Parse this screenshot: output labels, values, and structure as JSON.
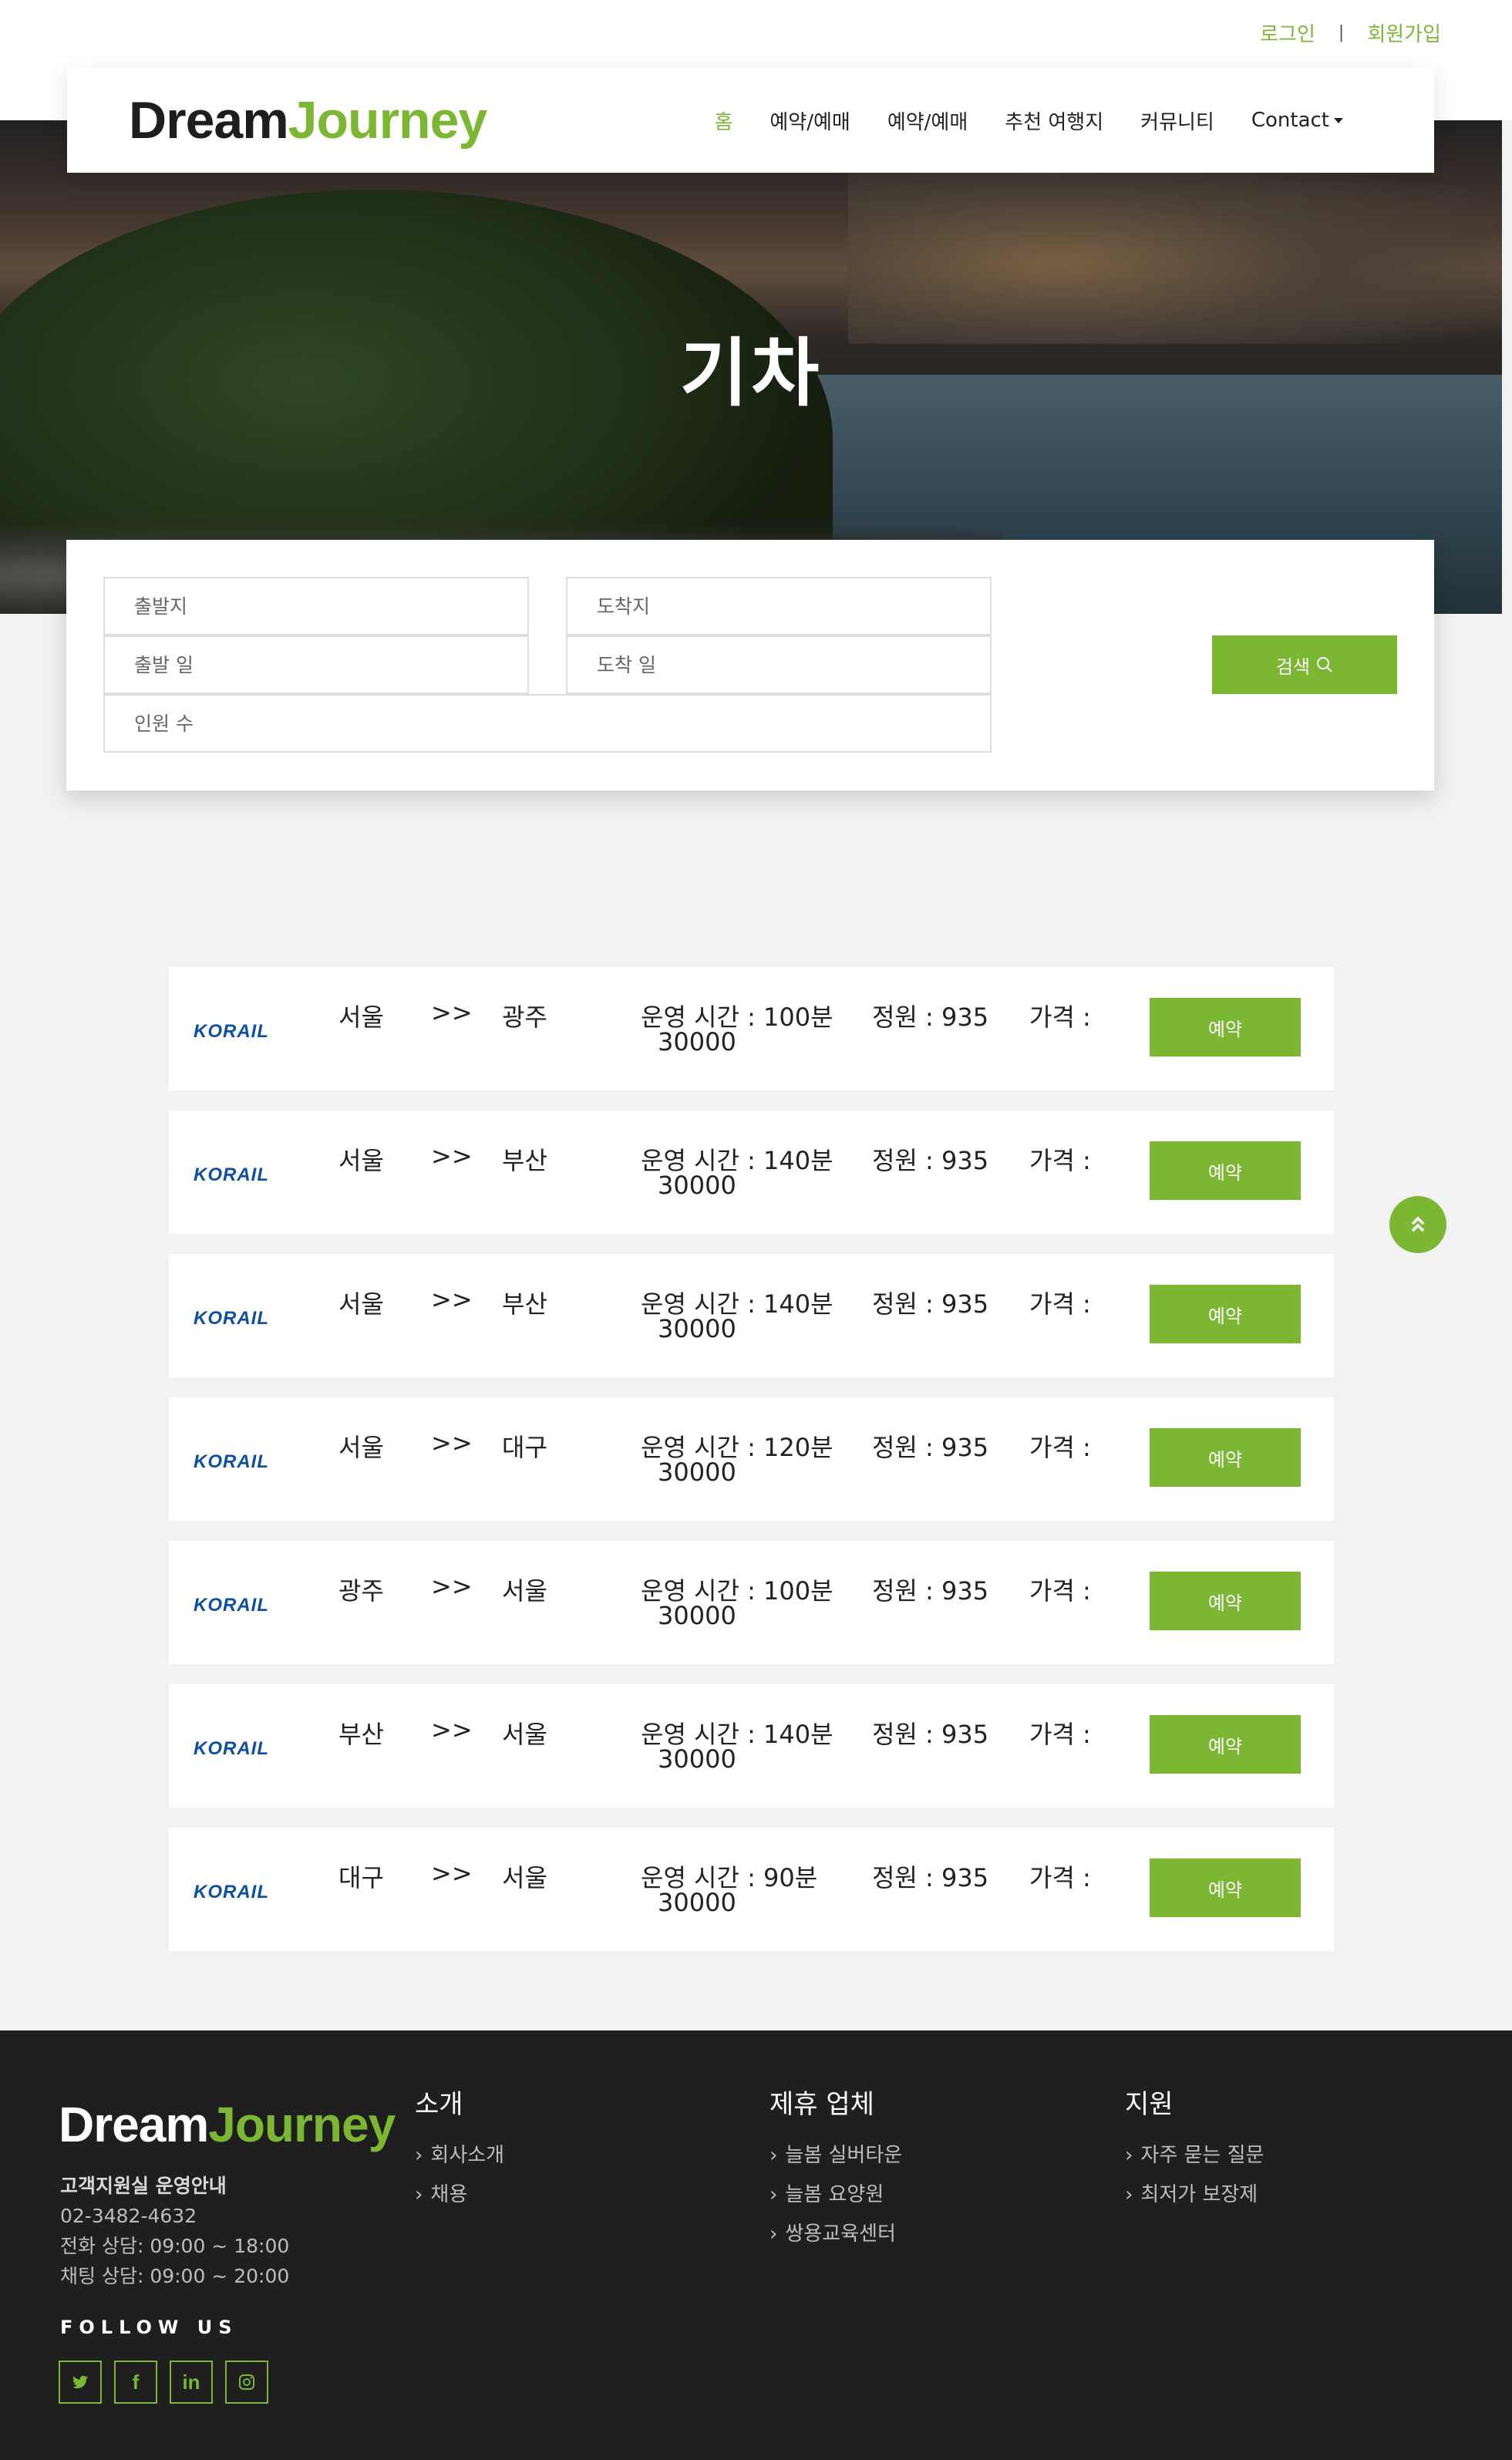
{
  "top_links": {
    "login": "로그인",
    "separator": "|",
    "signup": "회원가입"
  },
  "brand": {
    "part1": "Dream",
    "part2": "Journey"
  },
  "nav": {
    "items": [
      "홈",
      "예약/예매",
      "예약/예매",
      "추천 여행지",
      "커뮤니티",
      "Contact"
    ]
  },
  "hero": {
    "title": "기차"
  },
  "search": {
    "departure_placeholder": "출발지",
    "arrival_placeholder": "도착지",
    "depart_date_placeholder": "출발 일",
    "arrive_date_placeholder": "도착 일",
    "people_placeholder": "인원 수",
    "button_label": "검색"
  },
  "results": [
    {
      "logo": "KORAIL",
      "from": "서울",
      "arrow": ">>",
      "to": "광주",
      "time": "운영 시간 : 100분",
      "capacity": "정원 : 935",
      "price_label": "가격 :",
      "price": "30000",
      "button": "예약"
    },
    {
      "logo": "KORAIL",
      "from": "서울",
      "arrow": ">>",
      "to": "부산",
      "time": "운영 시간 : 140분",
      "capacity": "정원 : 935",
      "price_label": "가격 :",
      "price": "30000",
      "button": "예약"
    },
    {
      "logo": "KORAIL",
      "from": "서울",
      "arrow": ">>",
      "to": "부산",
      "time": "운영 시간 : 140분",
      "capacity": "정원 : 935",
      "price_label": "가격 :",
      "price": "30000",
      "button": "예약"
    },
    {
      "logo": "KORAIL",
      "from": "서울",
      "arrow": ">>",
      "to": "대구",
      "time": "운영 시간 : 120분",
      "capacity": "정원 : 935",
      "price_label": "가격 :",
      "price": "30000",
      "button": "예약"
    },
    {
      "logo": "KORAIL",
      "from": "광주",
      "arrow": ">>",
      "to": "서울",
      "time": "운영 시간 : 100분",
      "capacity": "정원 : 935",
      "price_label": "가격 :",
      "price": "30000",
      "button": "예약"
    },
    {
      "logo": "KORAIL",
      "from": "부산",
      "arrow": ">>",
      "to": "서울",
      "time": "운영 시간 : 140분",
      "capacity": "정원 : 935",
      "price_label": "가격 :",
      "price": "30000",
      "button": "예약"
    },
    {
      "logo": "KORAIL",
      "from": "대구",
      "arrow": ">>",
      "to": "서울",
      "time": "운영 시간 : 90분",
      "capacity": "정원 : 935",
      "price_label": "가격 :",
      "price": "30000",
      "button": "예약"
    }
  ],
  "footer": {
    "info_title": "고객지원실 운영안내",
    "phone": "02-3482-4632",
    "phone_hours": "전화 상담: 09:00 ~ 18:00",
    "chat_hours": "채팅 상담: 09:00 ~ 20:00",
    "follow": "FOLLOW US",
    "socials": [
      "twitter-icon",
      "facebook-icon",
      "linkedin-icon",
      "instagram-icon"
    ],
    "col1": {
      "title": "소개",
      "links": [
        "회사소개",
        "채용"
      ]
    },
    "col2": {
      "title": "제휴 업체",
      "links": [
        "늘봄 실버타운",
        "늘봄 요양원",
        "쌍용교육센터"
      ]
    },
    "col3": {
      "title": "지원",
      "links": [
        "자주 묻는 질문",
        "최저가 보장제"
      ]
    }
  },
  "colors": {
    "accent": "#7cb733",
    "footer_bg": "#1f1f1f",
    "page_bg": "#f2f2f2"
  }
}
